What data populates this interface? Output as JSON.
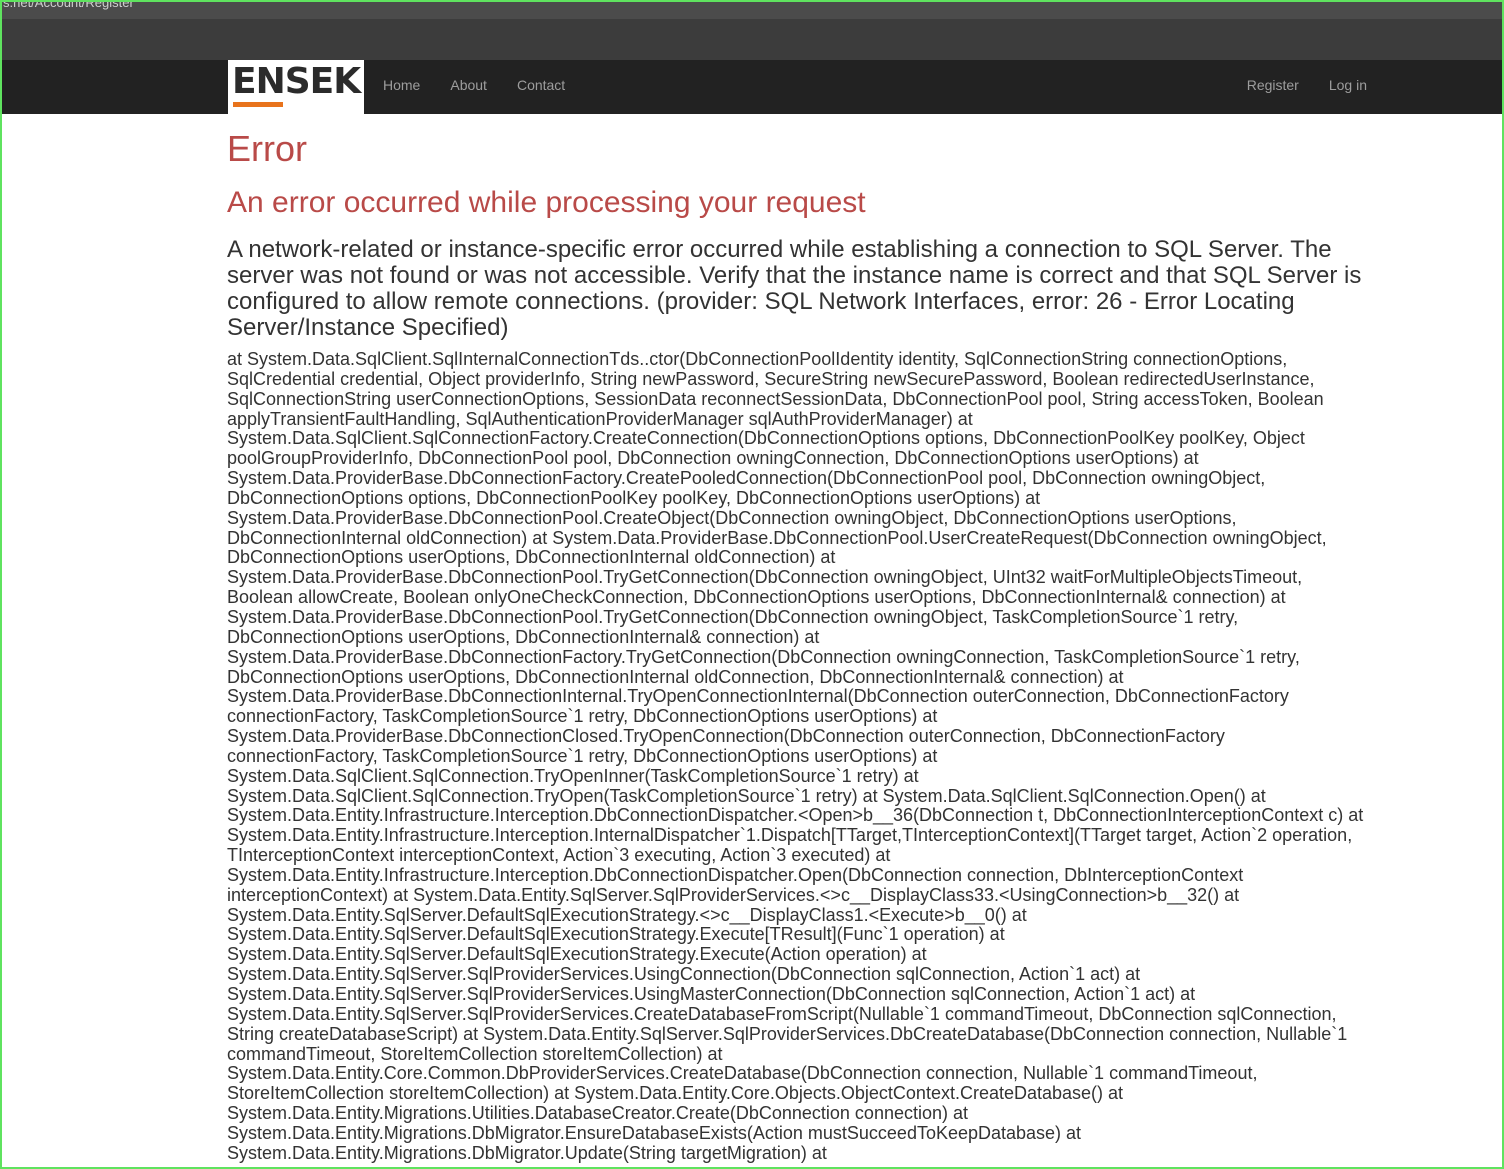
{
  "browser": {
    "url_fragment": "s.net/Account/Register"
  },
  "navbar": {
    "brand": "ENSEK",
    "left_links": [
      "Home",
      "About",
      "Contact"
    ],
    "right_links": [
      "Register",
      "Log in"
    ],
    "brand_accent_color": "#e8731c"
  },
  "error": {
    "title": "Error",
    "subtitle": "An error occurred while processing your request",
    "message": "A network-related or instance-specific error occurred while establishing a connection to SQL Server. The server was not found or was not accessible. Verify that the instance name is correct and that SQL Server is configured to allow remote connections. (provider: SQL Network Interfaces, error: 26 - Error Locating Server/Instance Specified)",
    "stack_trace": "at System.Data.SqlClient.SqlInternalConnectionTds..ctor(DbConnectionPoolIdentity identity, SqlConnectionString connectionOptions, SqlCredential credential, Object providerInfo, String newPassword, SecureString newSecurePassword, Boolean redirectedUserInstance, SqlConnectionString userConnectionOptions, SessionData reconnectSessionData, DbConnectionPool pool, String accessToken, Boolean applyTransientFaultHandling, SqlAuthenticationProviderManager sqlAuthProviderManager) at System.Data.SqlClient.SqlConnectionFactory.CreateConnection(DbConnectionOptions options, DbConnectionPoolKey poolKey, Object poolGroupProviderInfo, DbConnectionPool pool, DbConnection owningConnection, DbConnectionOptions userOptions) at System.Data.ProviderBase.DbConnectionFactory.CreatePooledConnection(DbConnectionPool pool, DbConnection owningObject, DbConnectionOptions options, DbConnectionPoolKey poolKey, DbConnectionOptions userOptions) at System.Data.ProviderBase.DbConnectionPool.CreateObject(DbConnection owningObject, DbConnectionOptions userOptions, DbConnectionInternal oldConnection) at System.Data.ProviderBase.DbConnectionPool.UserCreateRequest(DbConnection owningObject, DbConnectionOptions userOptions, DbConnectionInternal oldConnection) at System.Data.ProviderBase.DbConnectionPool.TryGetConnection(DbConnection owningObject, UInt32 waitForMultipleObjectsTimeout, Boolean allowCreate, Boolean onlyOneCheckConnection, DbConnectionOptions userOptions, DbConnectionInternal& connection) at System.Data.ProviderBase.DbConnectionPool.TryGetConnection(DbConnection owningObject, TaskCompletionSource`1 retry, DbConnectionOptions userOptions, DbConnectionInternal& connection) at System.Data.ProviderBase.DbConnectionFactory.TryGetConnection(DbConnection owningConnection, TaskCompletionSource`1 retry, DbConnectionOptions userOptions, DbConnectionInternal oldConnection, DbConnectionInternal& connection) at System.Data.ProviderBase.DbConnectionInternal.TryOpenConnectionInternal(DbConnection outerConnection, DbConnectionFactory connectionFactory, TaskCompletionSource`1 retry, DbConnectionOptions userOptions) at System.Data.ProviderBase.DbConnectionClosed.TryOpenConnection(DbConnection outerConnection, DbConnectionFactory connectionFactory, TaskCompletionSource`1 retry, DbConnectionOptions userOptions) at System.Data.SqlClient.SqlConnection.TryOpenInner(TaskCompletionSource`1 retry) at System.Data.SqlClient.SqlConnection.TryOpen(TaskCompletionSource`1 retry) at System.Data.SqlClient.SqlConnection.Open() at System.Data.Entity.Infrastructure.Interception.DbConnectionDispatcher.<Open>b__36(DbConnection t, DbConnectionInterceptionContext c) at System.Data.Entity.Infrastructure.Interception.InternalDispatcher`1.Dispatch[TTarget,TInterceptionContext](TTarget target, Action`2 operation, TInterceptionContext interceptionContext, Action`3 executing, Action`3 executed) at System.Data.Entity.Infrastructure.Interception.DbConnectionDispatcher.Open(DbConnection connection, DbInterceptionContext interceptionContext) at System.Data.Entity.SqlServer.SqlProviderServices.<>c__DisplayClass33.<UsingConnection>b__32() at System.Data.Entity.SqlServer.DefaultSqlExecutionStrategy.<>c__DisplayClass1.<Execute>b__0() at System.Data.Entity.SqlServer.DefaultSqlExecutionStrategy.Execute[TResult](Func`1 operation) at System.Data.Entity.SqlServer.DefaultSqlExecutionStrategy.Execute(Action operation) at System.Data.Entity.SqlServer.SqlProviderServices.UsingConnection(DbConnection sqlConnection, Action`1 act) at System.Data.Entity.SqlServer.SqlProviderServices.UsingMasterConnection(DbConnection sqlConnection, Action`1 act) at System.Data.Entity.SqlServer.SqlProviderServices.CreateDatabaseFromScript(Nullable`1 commandTimeout, DbConnection sqlConnection, String createDatabaseScript) at System.Data.Entity.SqlServer.SqlProviderServices.DbCreateDatabase(DbConnection connection, Nullable`1 commandTimeout, StoreItemCollection storeItemCollection) at System.Data.Entity.Core.Common.DbProviderServices.CreateDatabase(DbConnection connection, Nullable`1 commandTimeout, StoreItemCollection storeItemCollection) at System.Data.Entity.Core.Objects.ObjectContext.CreateDatabase() at System.Data.Entity.Migrations.Utilities.DatabaseCreator.Create(DbConnection connection) at System.Data.Entity.Migrations.DbMigrator.EnsureDatabaseExists(Action mustSucceedToKeepDatabase) at System.Data.Entity.Migrations.DbMigrator.Update(String targetMigration) at"
  }
}
